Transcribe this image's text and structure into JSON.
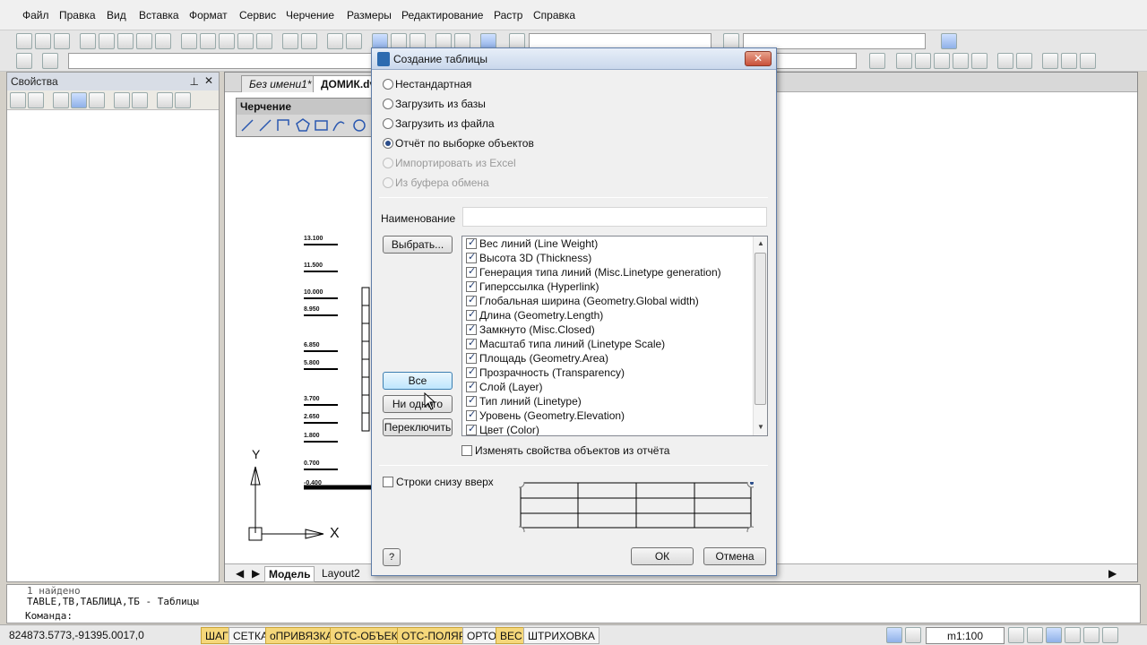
{
  "menu": [
    "Файл",
    "Правка",
    "Вид",
    "Вставка",
    "Формат",
    "Сервис",
    "Черчение",
    "Размеры",
    "Редактирование",
    "Растр",
    "Справка"
  ],
  "properties_panel": {
    "title": "Свойства",
    "pin_glyph": "⊥",
    "close_glyph": "✕"
  },
  "doc_tabs": [
    "Без имени1*",
    "ДОМИК.dv"
  ],
  "float_toolbar_title": "Черчение",
  "drawing": {
    "levels": [
      "13.100",
      "11.500",
      "10.000",
      "8.950",
      "6.850",
      "5.800",
      "3.700",
      "2.650",
      "1.800",
      "0.700",
      "-0.400"
    ],
    "ucs_x": "X",
    "ucs_y": "Y"
  },
  "layout_tabs": [
    "Модель",
    "Layout2"
  ],
  "command_line": {
    "line1": "1 найдено",
    "line2": "TABLE,TB,ТАБЛИЦА,ТБ - Таблицы",
    "prompt": "Команда:"
  },
  "status": {
    "coords": "824873.5773,-91395.0017,0",
    "toggles": [
      {
        "label": "ШАГ",
        "on": true
      },
      {
        "label": "СЕТКА",
        "on": false
      },
      {
        "label": "оПРИВЯЗКА",
        "on": true
      },
      {
        "label": "ОТС-ОБЪЕКТ",
        "on": true
      },
      {
        "label": "ОТС-ПОЛЯР",
        "on": true
      },
      {
        "label": "ОРТО",
        "on": false
      },
      {
        "label": "ВЕС",
        "on": true
      },
      {
        "label": "ШТРИХОВКА",
        "on": false
      }
    ],
    "scale": "m1:100"
  },
  "dialog": {
    "title": "Создание таблицы",
    "close_glyph": "✕",
    "options": [
      {
        "label": "Нестандартная",
        "checked": false,
        "disabled": false
      },
      {
        "label": "Загрузить из базы",
        "checked": false,
        "disabled": false
      },
      {
        "label": "Загрузить из файла",
        "checked": false,
        "disabled": false
      },
      {
        "label": "Отчёт по выборке объектов",
        "checked": true,
        "disabled": false
      },
      {
        "label": "Импортировать из Excel",
        "checked": false,
        "disabled": true
      },
      {
        "label": "Из буфера обмена",
        "checked": false,
        "disabled": true
      }
    ],
    "name_label": "Наименование",
    "name_value": "",
    "select_button": "Выбрать...",
    "all_button": "Все",
    "none_button": "Ни одного",
    "toggle_button": "Переключить",
    "properties": [
      "Вес линий (Line Weight)",
      "Высота 3D (Thickness)",
      "Генерация типа линий (Misc.Linetype generation)",
      "Гиперссылка (Hyperlink)",
      "Глобальная ширина (Geometry.Global width)",
      "Длина (Geometry.Length)",
      "Замкнуто (Misc.Closed)",
      "Масштаб типа линий (Linetype Scale)",
      "Площадь (Geometry.Area)",
      "Прозрачность (Transparency)",
      "Слой (Layer)",
      "Тип линий (Linetype)",
      "Уровень (Geometry.Elevation)",
      "Цвет (Color)"
    ],
    "modify_checkbox": "Изменять свойства объектов из отчёта",
    "bottom_up_checkbox": "Строки снизу вверх",
    "help_glyph": "?",
    "ok_button": "ОК",
    "cancel_button": "Отмена"
  }
}
